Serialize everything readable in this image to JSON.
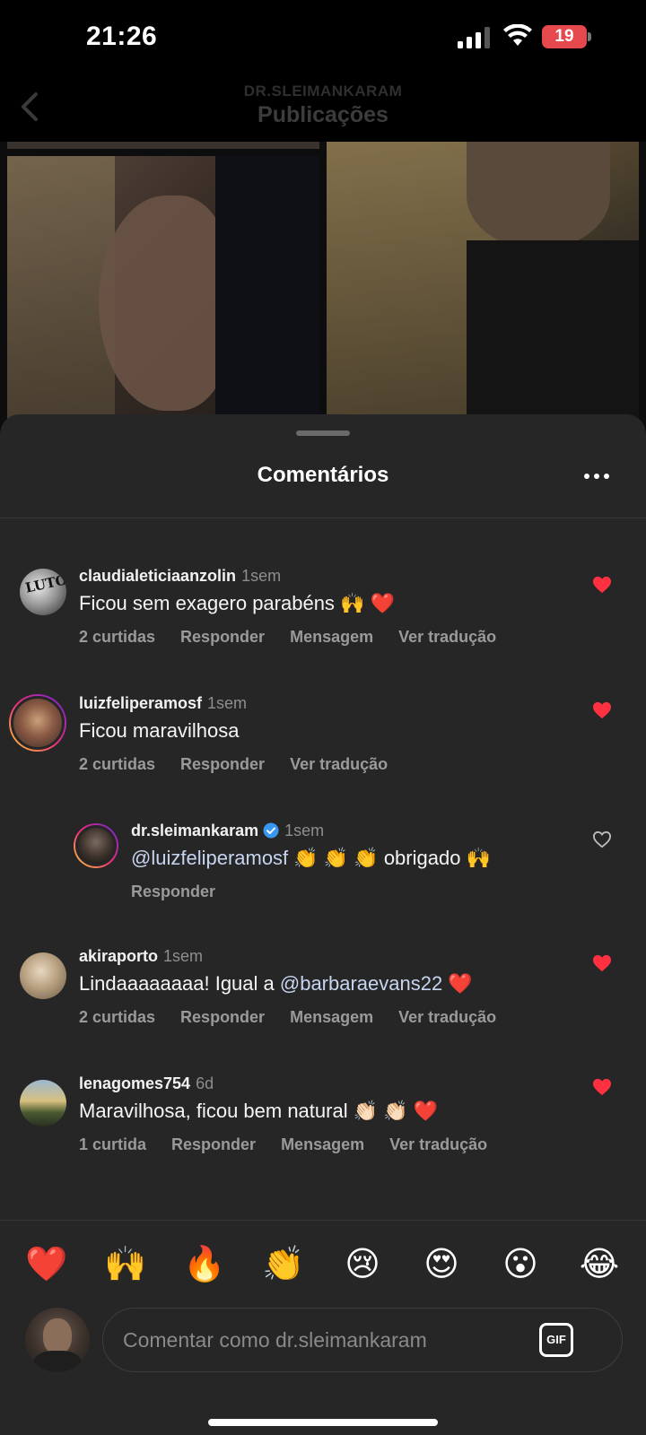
{
  "status_bar": {
    "time": "21:26",
    "battery": "19"
  },
  "header": {
    "account": "DR.SLEIMANKARAM",
    "title": "Publicações"
  },
  "sheet": {
    "title": "Comentários"
  },
  "comments": [
    {
      "username": "claudialeticiaanzolin",
      "time": "1sem",
      "text": "Ficou sem exagero parabéns 🙌 ❤️",
      "actions": [
        "2 curtidas",
        "Responder",
        "Mensagem",
        "Ver tradução"
      ],
      "liked": true
    },
    {
      "username": "luizfelipe­ramosf",
      "time": "1sem",
      "text": "Ficou maravilhosa",
      "actions": [
        "2 curtidas",
        "Responder",
        "Ver tradução"
      ],
      "liked": true
    },
    {
      "username": "dr.sleimankaram",
      "time": "1sem",
      "mention": "@luizfelipe­ramosf",
      "text": " 👏 👏 👏  obrigado 🙌",
      "actions": [
        "Responder"
      ],
      "liked": false,
      "verified": true
    },
    {
      "username": "akiraporto",
      "time": "1sem",
      "text_before": "Lindaaaaaaaa! Igual a ",
      "mention": "@barbaraevans22",
      "text_after": " ❤️",
      "actions": [
        "2 curtidas",
        "Responder",
        "Mensagem",
        "Ver tradução"
      ],
      "liked": true
    },
    {
      "username": "lenagomes754",
      "time": "6d",
      "text": "Maravilhosa, ficou bem natural 👏🏻 👏🏻 ❤️",
      "actions": [
        "1 curtida",
        "Responder",
        "Mensagem",
        "Ver tradução"
      ],
      "liked": true
    }
  ],
  "emoji_bar": [
    "❤️",
    "🙌",
    "🔥",
    "👏",
    "😢",
    "😍",
    "😮",
    "😂"
  ],
  "composer": {
    "placeholder": "Comentar como dr.sleimankaram",
    "gif_label": "GIF"
  },
  "colors": {
    "like_red": "#ff3040",
    "sheet_bg": "#262626",
    "mention": "#c7d5f0"
  }
}
